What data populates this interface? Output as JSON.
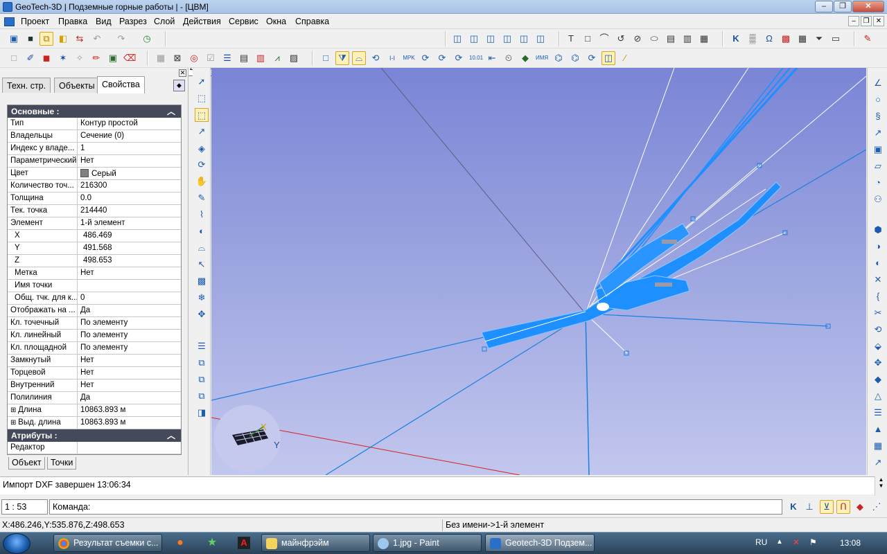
{
  "window": {
    "title": "GeoTech-3D | Подземные горные работы | - [ЦВМ]"
  },
  "menu": [
    "Проект",
    "Правка",
    "Вид",
    "Разрез",
    "Слой",
    "Действия",
    "Сервис",
    "Окна",
    "Справка"
  ],
  "coords": {
    "xg_label": "Xг",
    "xg_value": "486.469",
    "yg_label": "Yг",
    "yg_value": "491.568",
    "z_label": "Z",
    "z_value": "498.653"
  },
  "tabs": [
    "Техн. стр.",
    "Объекты",
    "Свойства"
  ],
  "properties": {
    "section_main": "Основные :",
    "rows": [
      {
        "k": "Тип",
        "v": "Контур простой"
      },
      {
        "k": "Владельцы",
        "v": "Сечение (0)"
      },
      {
        "k": "Индекс у владе...",
        "v": "1"
      },
      {
        "k": "Параметрический",
        "v": "Нет"
      },
      {
        "k": "Цвет",
        "v": "Серый"
      },
      {
        "k": "Количество точ...",
        "v": "216300"
      },
      {
        "k": "Толщина",
        "v": "0.0"
      },
      {
        "k": "Тек. точка",
        "v": "214440"
      },
      {
        "k": "Элемент",
        "v": "1-й элемент"
      },
      {
        "k": "X",
        "v": "486.469"
      },
      {
        "k": "Y",
        "v": "491.568"
      },
      {
        "k": "Z",
        "v": "498.653"
      },
      {
        "k": "Метка",
        "v": "Нет"
      },
      {
        "k": "Имя точки",
        "v": ""
      },
      {
        "k": "Общ. тчк. для к...",
        "v": "0"
      },
      {
        "k": "Отображать на ...",
        "v": "Да"
      },
      {
        "k": "Кл. точечный",
        "v": "По элементу"
      },
      {
        "k": "Кл. линейный",
        "v": "По элементу"
      },
      {
        "k": "Кл. площадной",
        "v": "По элементу"
      },
      {
        "k": "Замкнутый",
        "v": "Нет"
      },
      {
        "k": "Торцевой",
        "v": "Нет"
      },
      {
        "k": "Внутренний",
        "v": "Нет"
      },
      {
        "k": "Полилиния",
        "v": "Да"
      },
      {
        "k": "Длина",
        "v": "10863.893 м"
      },
      {
        "k": "Выд. длина",
        "v": "10863.893 м"
      }
    ],
    "section_attr": "Атрибуты :",
    "attr_rows": [
      {
        "k": "Редактор",
        "v": ""
      }
    ]
  },
  "bottom_tabs": [
    "Объект",
    "Точки"
  ],
  "axes": {
    "x": "X",
    "y": "Y"
  },
  "message": "Импорт DXF завершен 13:06:34",
  "scale": "1 : 53",
  "command_label": "Команда:",
  "status": {
    "coords": "X:486.246,Y:535.876,Z:498.653",
    "element": "Без имени->1-й элемент"
  },
  "taskbar": {
    "items": [
      "Результат съемки с...",
      "майнфрэйм",
      "1.jpg - Paint",
      "Geotech-3D Подзем..."
    ],
    "lang": "RU",
    "time": "13:08"
  },
  "colors": {
    "viewport_top": "#7a85d6",
    "viewport_bottom": "#c2c7ee",
    "model_blue": "#1e8fff",
    "section_header": "#444a5a"
  }
}
